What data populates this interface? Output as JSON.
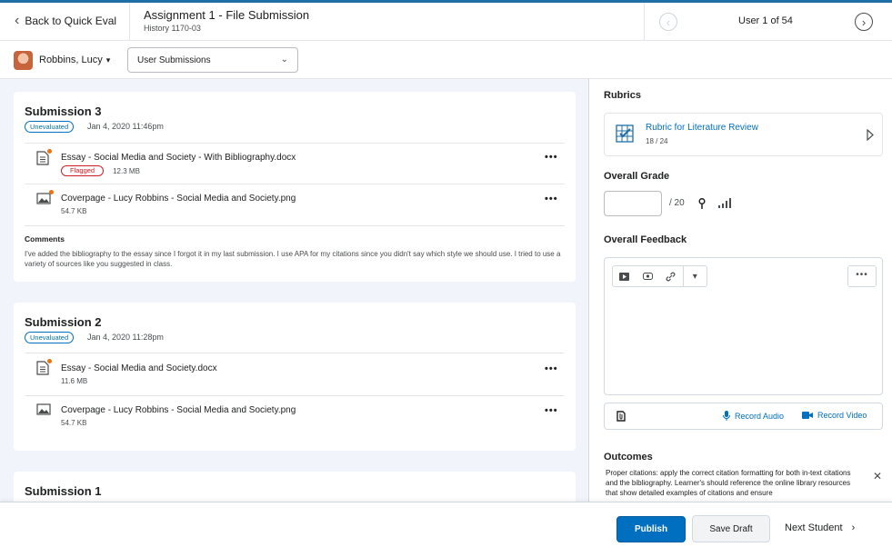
{
  "header": {
    "back_label": "Back to Quick Eval",
    "title": "Assignment 1 - File Submission",
    "subtitle": "History 1170-03",
    "user_count": "User 1 of 54"
  },
  "subbar": {
    "student_name": "Robbins, Lucy",
    "view_select": "User Submissions"
  },
  "submissions": [
    {
      "title": "Submission 3",
      "status": "Unevaluated",
      "date": "Jan 4, 2020 11:46pm",
      "files": [
        {
          "name": "Essay - Social Media and Society - With Bibliography.docx",
          "flag": "Flagged",
          "size": "12.3 MB",
          "icon": "document-icon"
        },
        {
          "name": "Coverpage - Lucy Robbins - Social Media and Society.png",
          "size": "54.7 KB",
          "icon": "image-icon"
        }
      ],
      "comments_label": "Comments",
      "comments": "I've added the bibliography to the essay since I forgot it in my last submission. I use APA for my citations since you didn't say which style we should use. I tried to use a variety of sources like you suggested in class."
    },
    {
      "title": "Submission 2",
      "status": "Unevaluated",
      "date": "Jan 4, 2020 11:28pm",
      "files": [
        {
          "name": "Essay - Social Media and Society.docx",
          "size": "11.6 MB",
          "icon": "document-icon"
        },
        {
          "name": "Coverpage - Lucy Robbins - Social Media and Society.png",
          "size": "54.7 KB",
          "icon": "image-icon"
        }
      ]
    },
    {
      "title": "Submission 1"
    }
  ],
  "right": {
    "rubrics_heading": "Rubrics",
    "rubric_name": "Rubric for Literature Review",
    "rubric_score": "18 / 24",
    "grade_heading": "Overall Grade",
    "grade_out_of": "/ 20",
    "feedback_heading": "Overall Feedback",
    "record_audio": "Record Audio",
    "record_video": "Record Video",
    "outcomes_heading": "Outcomes",
    "outcome_text": "Proper citations: apply the correct citation formatting for both in-text citations and the bibliography. Learner's should reference the online library resources that show detailed examples of citations and ensure"
  },
  "footer": {
    "publish": "Publish",
    "save_draft": "Save Draft",
    "next_student": "Next Student"
  },
  "colors": {
    "accent": "#006fbf",
    "top_bar": "#1e6ea7",
    "flag": "#cd2026",
    "notification_dot": "#e87511",
    "pane_background": "#f1f5fb"
  }
}
